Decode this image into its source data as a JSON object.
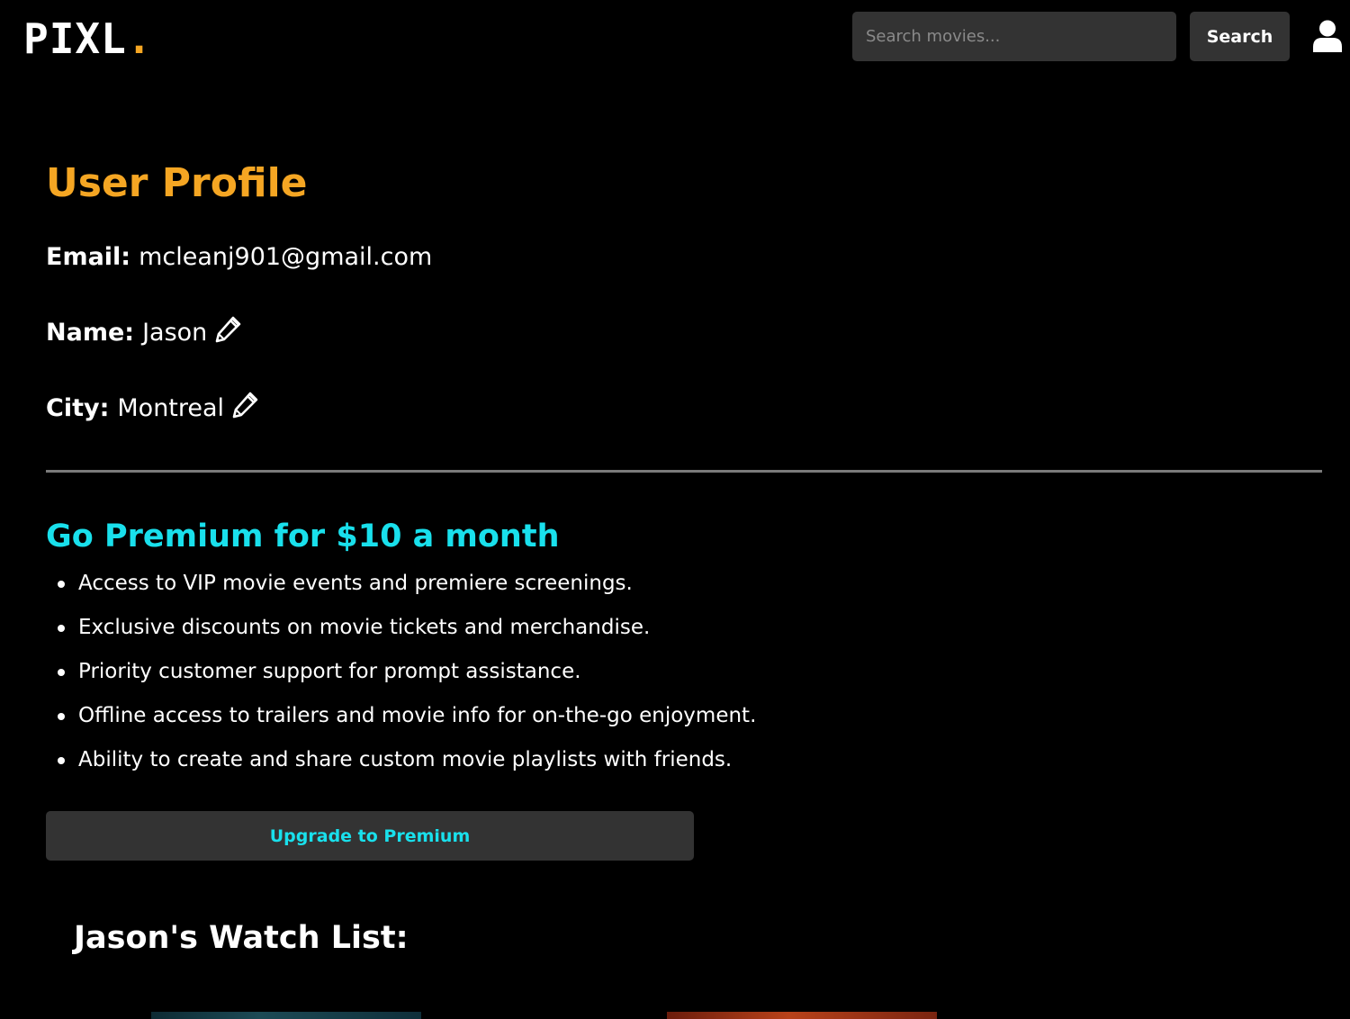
{
  "header": {
    "logo_text": "PIXL",
    "logo_dot": ".",
    "search_placeholder": "Search movies...",
    "search_value": "",
    "search_button_label": "Search",
    "user_icon": "user-icon"
  },
  "profile": {
    "title": "User Profile",
    "email_label": "Email:",
    "email_value": "mcleanj901@gmail.com",
    "name_label": "Name:",
    "name_value": "Jason",
    "city_label": "City:",
    "city_value": "Montreal",
    "edit_icon": "pencil-icon"
  },
  "premium": {
    "title": "Go Premium for $10 a month",
    "benefits": [
      "Access to VIP movie events and premiere screenings.",
      "Exclusive discounts on movie tickets and merchandise.",
      "Priority customer support for prompt assistance.",
      "Offline access to trailers and movie info for on-the-go enjoyment.",
      "Ability to create and share custom movie playlists with friends."
    ],
    "upgrade_button_label": "Upgrade to Premium"
  },
  "watchlist": {
    "title": "Jason's Watch List:"
  },
  "colors": {
    "background": "#000000",
    "accent_orange": "#f5a623",
    "accent_cyan": "#19e0ec",
    "control_bg": "#333333"
  }
}
